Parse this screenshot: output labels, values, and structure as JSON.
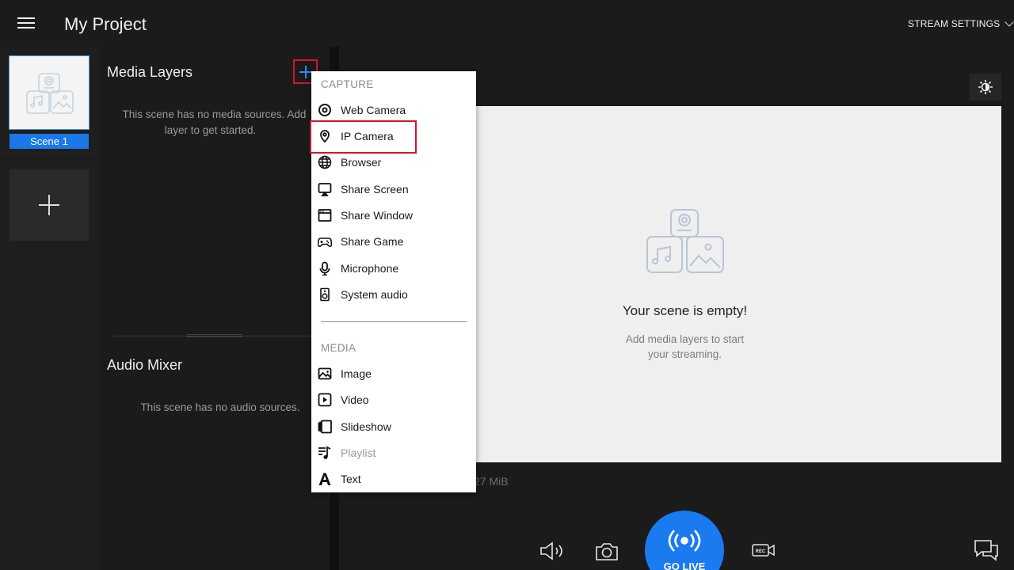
{
  "header": {
    "title": "My Project",
    "stream_settings": "STREAM SETTINGS"
  },
  "scenes": [
    {
      "label": "Scene 1",
      "selected": true
    }
  ],
  "media_layers": {
    "title": "Media Layers",
    "empty_line1": "This scene has no media sources. Add",
    "empty_line2": "layer to get started."
  },
  "audio_mixer": {
    "title": "Audio Mixer",
    "empty": "This scene has no audio sources."
  },
  "preview": {
    "empty_title": "Your scene is empty!",
    "empty_sub_line1": "Add media layers to start",
    "empty_sub_line2": "your streaming.",
    "memory_text": "27 MiB"
  },
  "controls": {
    "go_live": "GO LIVE"
  },
  "add_menu": {
    "capture_header": "CAPTURE",
    "capture_items": [
      {
        "label": "Web Camera",
        "icon": "webcam-icon"
      },
      {
        "label": "IP Camera",
        "icon": "ip-camera-icon",
        "highlighted": true
      },
      {
        "label": "Browser",
        "icon": "globe-icon"
      },
      {
        "label": "Share Screen",
        "icon": "screen-icon"
      },
      {
        "label": "Share Window",
        "icon": "window-icon"
      },
      {
        "label": "Share Game",
        "icon": "gamepad-icon"
      },
      {
        "label": "Microphone",
        "icon": "microphone-icon"
      },
      {
        "label": "System audio",
        "icon": "speaker-icon"
      }
    ],
    "media_header": "MEDIA",
    "media_items": [
      {
        "label": "Image",
        "icon": "image-icon"
      },
      {
        "label": "Video",
        "icon": "video-icon"
      },
      {
        "label": "Slideshow",
        "icon": "slideshow-icon"
      },
      {
        "label": "Playlist",
        "icon": "playlist-icon",
        "disabled": true
      },
      {
        "label": "Text",
        "icon": "text-icon"
      }
    ]
  },
  "colors": {
    "accent": "#1a7af0",
    "highlight_outline": "#d1172f",
    "background": "#1b1b1b"
  }
}
